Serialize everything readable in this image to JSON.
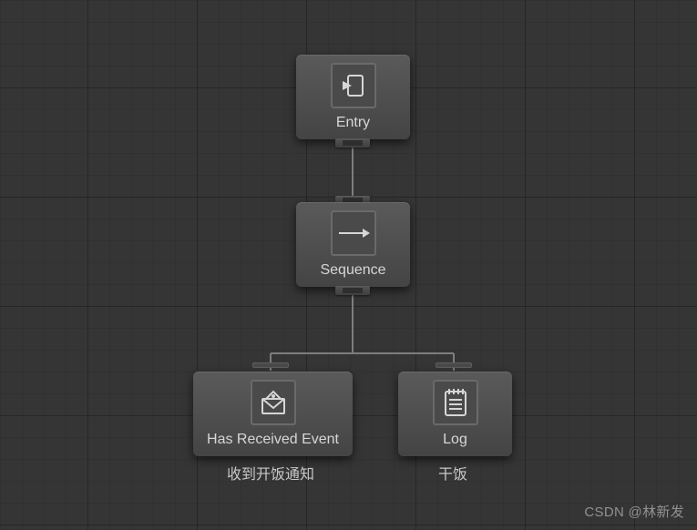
{
  "nodes": {
    "entry": {
      "label": "Entry",
      "icon": "entry-icon"
    },
    "sequence": {
      "label": "Sequence",
      "icon": "arrow-right-icon"
    },
    "hasReceivedEvent": {
      "label": "Has Received Event",
      "icon": "envelope-icon",
      "caption": "收到开饭通知"
    },
    "log": {
      "label": "Log",
      "icon": "notepad-icon",
      "caption": "干饭"
    }
  },
  "watermark": "CSDN @林新发"
}
